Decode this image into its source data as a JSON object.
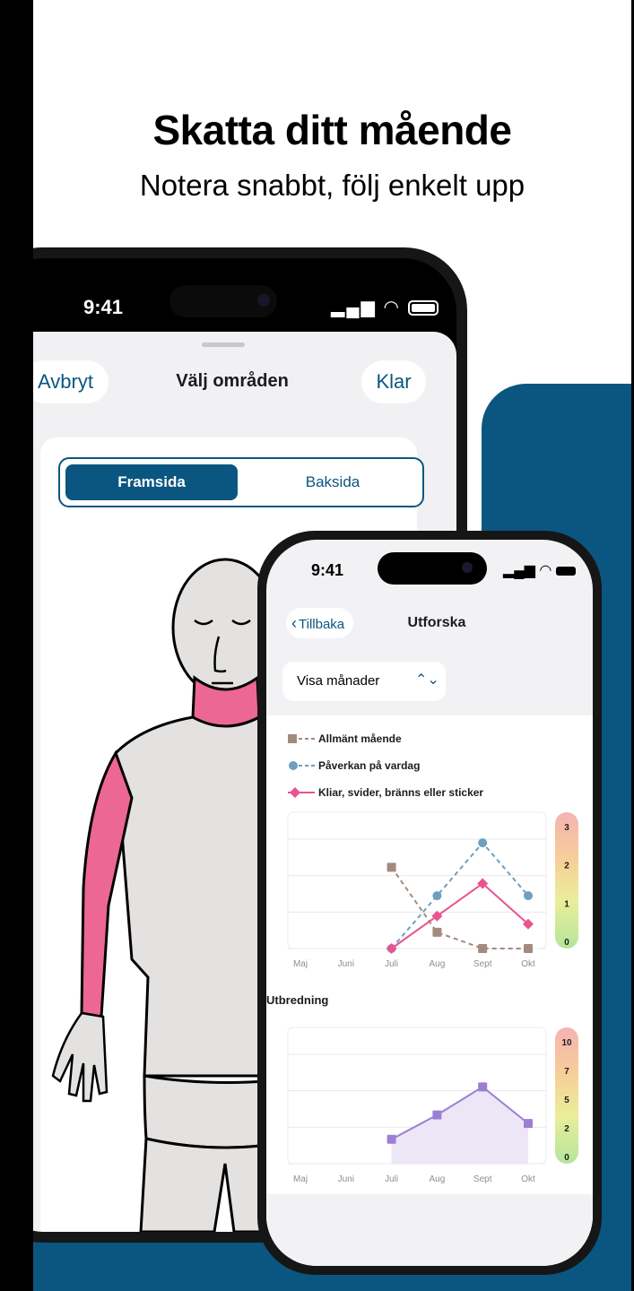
{
  "headline": "Skatta ditt mående",
  "subheadline": "Notera snabbt, följ enkelt upp",
  "phone_back": {
    "status_time": "9:41",
    "cancel_label": "Avbryt",
    "title": "Välj områden",
    "done_label": "Klar",
    "segments": [
      "Framsida",
      "Baksida"
    ],
    "selected_segment": "Framsida",
    "highlight_color": "#ec6794"
  },
  "phone_front": {
    "status_time": "9:41",
    "back_label": "Tillbaka",
    "title": "Utforska",
    "select_value": "Visa månader",
    "legend": [
      {
        "label": "Allmänt mående",
        "color": "#a48a7e",
        "marker": "square",
        "line": "dashed"
      },
      {
        "label": "Påverkan på vardag",
        "color": "#6e9fbf",
        "marker": "circle",
        "line": "dashed"
      },
      {
        "label": "Kliar, svider, bränns eller sticker",
        "color": "#e8548f",
        "marker": "diamond",
        "line": "solid"
      }
    ],
    "section_title": "Utbredning"
  },
  "chart_data": [
    {
      "type": "line",
      "categories": [
        "Maj",
        "Juni",
        "Juli",
        "Aug",
        "Sept",
        "Okt"
      ],
      "ylim": [
        0,
        3
      ],
      "scale_labels": [
        "3",
        "2",
        "1",
        "0"
      ],
      "series": [
        {
          "name": "Allmänt mående",
          "values": [
            null,
            null,
            2,
            0.4,
            0,
            0
          ]
        },
        {
          "name": "Påverkan på vardag",
          "values": [
            null,
            null,
            0,
            1.3,
            2.6,
            1.3
          ]
        },
        {
          "name": "Kliar, svider, bränns eller sticker",
          "values": [
            null,
            null,
            0,
            0.8,
            1.6,
            0.6
          ]
        }
      ]
    },
    {
      "type": "area",
      "title": "Utbredning",
      "categories": [
        "Maj",
        "Juni",
        "Juli",
        "Aug",
        "Sept",
        "Okt"
      ],
      "ylim": [
        0,
        10
      ],
      "scale_labels": [
        "10",
        "7",
        "5",
        "2",
        "0"
      ],
      "series": [
        {
          "values": [
            null,
            null,
            2,
            4,
            6.3,
            3.3
          ]
        }
      ]
    }
  ]
}
